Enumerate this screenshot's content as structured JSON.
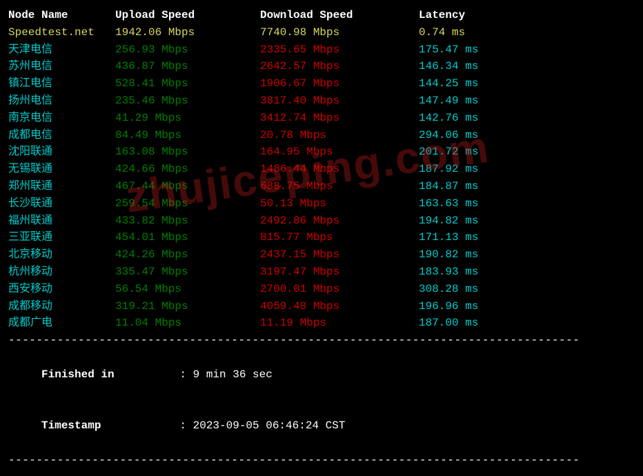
{
  "headers": {
    "node": "Node Name",
    "upload": "Upload Speed",
    "download": "Download Speed",
    "latency": "Latency"
  },
  "unit_speed": "Mbps",
  "unit_latency": "ms",
  "speedtest_row": {
    "node": "Speedtest.net",
    "upload": "1942.06",
    "download": "7740.98",
    "latency": "0.74"
  },
  "rows": [
    {
      "node": "天津电信",
      "upload": "256.93",
      "download": "2335.65",
      "latency": "175.47"
    },
    {
      "node": "苏州电信",
      "upload": "436.87",
      "download": "2642.57",
      "latency": "146.34"
    },
    {
      "node": "镇江电信",
      "upload": "528.41",
      "download": "1906.67",
      "latency": "144.25"
    },
    {
      "node": "扬州电信",
      "upload": "235.46",
      "download": "3817.40",
      "latency": "147.49"
    },
    {
      "node": "南京电信",
      "upload": "41.29",
      "download": "3412.74",
      "latency": "142.76"
    },
    {
      "node": "成都电信",
      "upload": "84.49",
      "download": "20.78",
      "latency": "294.06"
    },
    {
      "node": "沈阳联通",
      "upload": "163.08",
      "download": "164.95",
      "latency": "201.72"
    },
    {
      "node": "无锡联通",
      "upload": "424.66",
      "download": "1486.44",
      "latency": "187.92"
    },
    {
      "node": "郑州联通",
      "upload": "467.44",
      "download": "688.75",
      "latency": "184.87"
    },
    {
      "node": "长沙联通",
      "upload": "259.54",
      "download": "50.13",
      "latency": "163.63"
    },
    {
      "node": "福州联通",
      "upload": "433.82",
      "download": "2492.86",
      "latency": "194.82"
    },
    {
      "node": "三亚联通",
      "upload": "454.01",
      "download": "815.77",
      "latency": "171.13"
    },
    {
      "node": "北京移动",
      "upload": "424.26",
      "download": "2437.15",
      "latency": "190.82"
    },
    {
      "node": "杭州移动",
      "upload": "335.47",
      "download": "3197.47",
      "latency": "183.93"
    },
    {
      "node": "西安移动",
      "upload": "56.54",
      "download": "2700.01",
      "latency": "308.28"
    },
    {
      "node": "成都移动",
      "upload": "319.21",
      "download": "4059.48",
      "latency": "196.96"
    },
    {
      "node": "成都广电",
      "upload": "11.04",
      "download": "11.19",
      "latency": "187.00"
    }
  ],
  "footer": {
    "finished_label": "Finished in",
    "finished_value": "9 min 36 sec",
    "timestamp_label": "Timestamp",
    "timestamp_value": "2023-09-05 06:46:24 CST"
  },
  "watermark": "zhujiceping.com"
}
